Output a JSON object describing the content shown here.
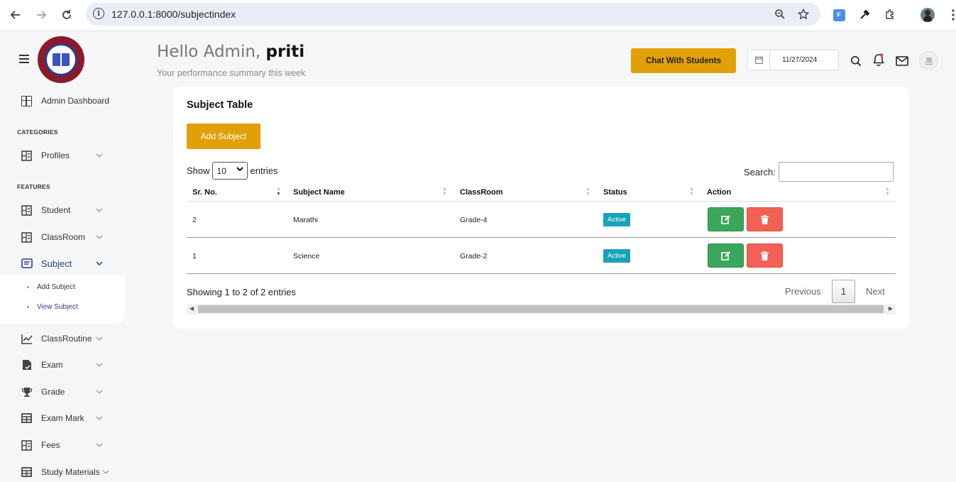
{
  "browser": {
    "url": "127.0.0.1:8000/subjectindex"
  },
  "sidebar": {
    "section_categories": "CATEGORIES",
    "section_features": "FEATURES",
    "items": [
      {
        "label": "Admin Dashboard",
        "icon": "grid-icon"
      },
      {
        "label": "Profiles",
        "icon": "profile-icon"
      },
      {
        "label": "Student",
        "icon": "student-icon"
      },
      {
        "label": "ClassRoom",
        "icon": "classroom-icon"
      },
      {
        "label": "Subject",
        "icon": "subject-icon"
      },
      {
        "label": "ClassRoutine",
        "icon": "chart-line-icon"
      },
      {
        "label": "Exam",
        "icon": "exam-icon"
      },
      {
        "label": "Grade",
        "icon": "trophy-icon"
      },
      {
        "label": "Exam Mark",
        "icon": "table-icon"
      },
      {
        "label": "Fees",
        "icon": "fees-icon"
      },
      {
        "label": "Study Materials",
        "icon": "table-icon"
      }
    ],
    "subject_submenu": [
      "Add Subject",
      "View Subject"
    ]
  },
  "header": {
    "greeting_prefix": "Hello Admin,",
    "user_name": "priti",
    "subtitle": "Your performance summary this week",
    "chat_button": "Chat With Students",
    "date": "11/27/2024"
  },
  "card": {
    "title": "Subject Table",
    "add_button": "Add Subject",
    "show_label": "Show",
    "entries_value": "10",
    "entries_label": "entries",
    "search_label": "Search:",
    "columns": [
      "Sr. No.",
      "Subject Name",
      "ClassRoom",
      "Status",
      "Action"
    ],
    "rows": [
      {
        "sr": "2",
        "subject": "Marathi",
        "classroom": "Grade-4",
        "status": "Active"
      },
      {
        "sr": "1",
        "subject": "Science",
        "classroom": "Grade-2",
        "status": "Active"
      }
    ],
    "info": "Showing 1 to 2 of 2 entries",
    "prev": "Previous",
    "page": "1",
    "next": "Next"
  },
  "colors": {
    "accent": "#e2a008",
    "active_badge": "#17a2b8",
    "edit": "#3ca65a",
    "delete": "#f36056",
    "nav_active": "#2d3a8c"
  }
}
